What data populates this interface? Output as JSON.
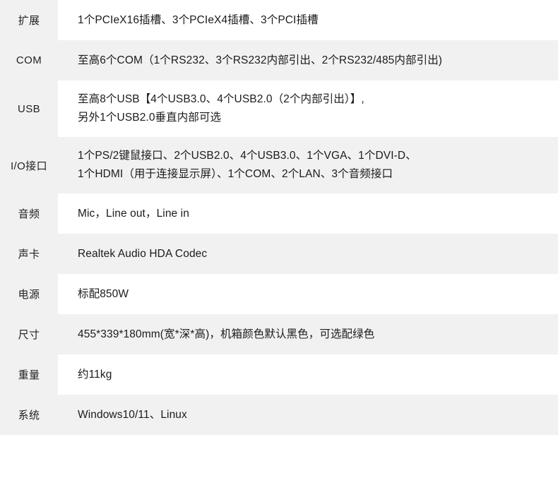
{
  "table": {
    "rows": [
      {
        "label": "扩展",
        "lines": [
          "1个PCIeX16插槽、3个PCIeX4插槽、3个PCI插槽"
        ],
        "shaded": false,
        "tall": false
      },
      {
        "label": "COM",
        "lines": [
          "至高6个COM（1个RS232、3个RS232内部引出、2个RS232/485内部引出)"
        ],
        "shaded": true,
        "tall": false
      },
      {
        "label": "USB",
        "lines": [
          "至高8个USB【4个USB3.0、4个USB2.0（2个内部引出）】,",
          "另外1个USB2.0垂直内部可选"
        ],
        "shaded": false,
        "tall": true
      },
      {
        "label": "I/O接口",
        "lines": [
          "1个PS/2键鼠接口、2个USB2.0、4个USB3.0、1个VGA、1个DVI-D、",
          "1个HDMI（用于连接显示屏）、1个COM、2个LAN、3个音频接口"
        ],
        "shaded": true,
        "tall": true
      },
      {
        "label": "音频",
        "lines": [
          "Mic，Line out，Line in"
        ],
        "shaded": false,
        "tall": false
      },
      {
        "label": "声卡",
        "lines": [
          "Realtek Audio HDA Codec"
        ],
        "shaded": true,
        "tall": false
      },
      {
        "label": "电源",
        "lines": [
          "标配850W"
        ],
        "shaded": false,
        "tall": false
      },
      {
        "label": "尺寸",
        "lines": [
          "455*339*180mm(宽*深*高)，机箱颜色默认黑色，可选配绿色"
        ],
        "shaded": true,
        "tall": false
      },
      {
        "label": "重量",
        "lines": [
          "约11kg"
        ],
        "shaded": false,
        "tall": false
      },
      {
        "label": "系统",
        "lines": [
          "Windows10/11、Linux"
        ],
        "shaded": true,
        "tall": false
      }
    ]
  },
  "colors": {
    "shade": "#f1f1f1",
    "white": "#ffffff",
    "text": "#1b1b1b",
    "label_text": "#222222"
  }
}
